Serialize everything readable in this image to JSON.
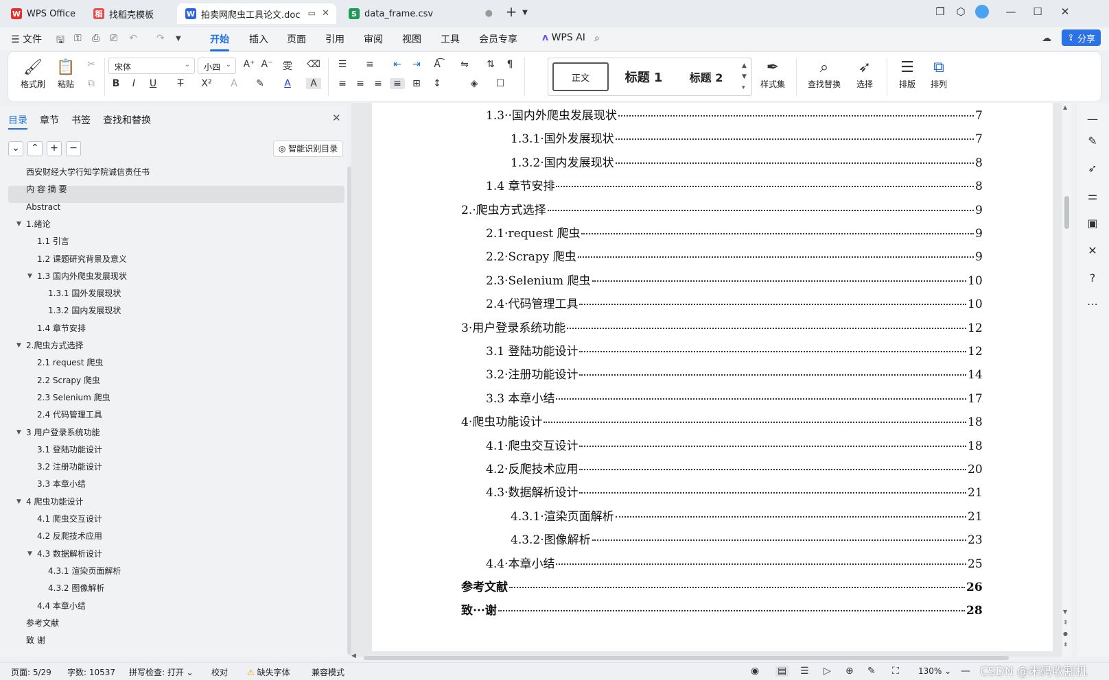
{
  "tabs": [
    {
      "label": "WPS Office",
      "icon": "wps-logo",
      "color": "#e0312b"
    },
    {
      "label": "找稻壳模板",
      "icon": "docer-icon",
      "color": "#e64c4c"
    },
    {
      "label": "拍卖网爬虫工具论文.doc",
      "icon": "word-doc-icon",
      "color": "#2b64e6",
      "active": true
    },
    {
      "label": "data_frame.csv",
      "icon": "sheet-icon",
      "color": "#1f9a55"
    }
  ],
  "menu": {
    "file": "文件",
    "items": [
      "开始",
      "插入",
      "页面",
      "引用",
      "审阅",
      "视图",
      "工具",
      "会员专享"
    ],
    "active": "开始",
    "wps_ai": "WPS AI",
    "share": "分享"
  },
  "ribbon": {
    "format_painter": "格式刷",
    "paste": "粘贴",
    "font": "宋体",
    "size": "小四",
    "styles": [
      "正文",
      "标题 1",
      "标题 2"
    ],
    "style_set": "样式集",
    "find_replace": "查找替换",
    "select": "选择",
    "layout": "排版",
    "arrange": "排列"
  },
  "sidebar": {
    "tabs": [
      "目录",
      "章节",
      "书签",
      "查找和替换"
    ],
    "active_tab": "目录",
    "smart_button": "智能识别目录",
    "items": [
      {
        "label": "西安财经大学行知学院诚信责任书",
        "level": 0,
        "arrow": ""
      },
      {
        "label": "内 容 摘 要",
        "level": 0,
        "arrow": "",
        "selected": true
      },
      {
        "label": "Abstract",
        "level": 0,
        "arrow": ""
      },
      {
        "label": "1.绪论",
        "level": 0,
        "arrow": "▼"
      },
      {
        "label": "1.1  引言",
        "level": 1,
        "arrow": ""
      },
      {
        "label": "1.2  课题研究背景及意义",
        "level": 1,
        "arrow": ""
      },
      {
        "label": "1.3    国内外爬虫发展现状",
        "level": 1,
        "arrow": "▼"
      },
      {
        "label": "1.3.1  国外发展现状",
        "level": 2,
        "arrow": ""
      },
      {
        "label": "1.3.2  国内发展现状",
        "level": 2,
        "arrow": ""
      },
      {
        "label": "1.4 章节安排",
        "level": 1,
        "arrow": ""
      },
      {
        "label": "2.爬虫方式选择",
        "level": 0,
        "arrow": "▼"
      },
      {
        "label": "2.1  request 爬虫",
        "level": 1,
        "arrow": ""
      },
      {
        "label": "2.2  Scrapy 爬虫",
        "level": 1,
        "arrow": ""
      },
      {
        "label": "2.3  Selenium 爬虫",
        "level": 1,
        "arrow": ""
      },
      {
        "label": "2.4  代码管理工具",
        "level": 1,
        "arrow": ""
      },
      {
        "label": "3  用户登录系统功能",
        "level": 0,
        "arrow": "▼"
      },
      {
        "label": "3.1 登陆功能设计",
        "level": 1,
        "arrow": ""
      },
      {
        "label": "3.2  注册功能设计",
        "level": 1,
        "arrow": ""
      },
      {
        "label": "3.3 本章小结",
        "level": 1,
        "arrow": ""
      },
      {
        "label": "4  爬虫功能设计",
        "level": 0,
        "arrow": "▼"
      },
      {
        "label": "4.1  爬虫交互设计",
        "level": 1,
        "arrow": ""
      },
      {
        "label": "4.2  反爬技术应用",
        "level": 1,
        "arrow": ""
      },
      {
        "label": "4.3  数据解析设计",
        "level": 1,
        "arrow": "▼"
      },
      {
        "label": "4.3.1  渲染页面解析",
        "level": 2,
        "arrow": ""
      },
      {
        "label": "4.3.2  图像解析",
        "level": 2,
        "arrow": ""
      },
      {
        "label": "4.4  本章小结",
        "level": 1,
        "arrow": ""
      },
      {
        "label": "参考文献",
        "level": 0,
        "arrow": ""
      },
      {
        "label": "致    谢",
        "level": 0,
        "arrow": ""
      }
    ]
  },
  "document": {
    "toc": [
      {
        "text": "1.3··国内外爬虫发展现状",
        "page": "7",
        "level": 1
      },
      {
        "text": "1.3.1·国外发展现状",
        "page": "7",
        "level": 2
      },
      {
        "text": "1.3.2·国内发展现状",
        "page": "8",
        "level": 2
      },
      {
        "text": "1.4 章节安排",
        "page": "8",
        "level": 1
      },
      {
        "text": "2.·爬虫方式选择",
        "page": "9",
        "level": 0
      },
      {
        "text": "2.1·request 爬虫",
        "page": "9",
        "level": 1
      },
      {
        "text": "2.2·Scrapy 爬虫",
        "page": "9",
        "level": 1
      },
      {
        "text": "2.3·Selenium 爬虫",
        "page": "10",
        "level": 1
      },
      {
        "text": "2.4·代码管理工具",
        "page": "10",
        "level": 1
      },
      {
        "text": "3·用户登录系统功能",
        "page": "12",
        "level": 0
      },
      {
        "text": "3.1 登陆功能设计",
        "page": "12",
        "level": 1
      },
      {
        "text": "3.2·注册功能设计",
        "page": "14",
        "level": 1
      },
      {
        "text": "3.3 本章小结",
        "page": "17",
        "level": 1
      },
      {
        "text": "4·爬虫功能设计",
        "page": "18",
        "level": 0
      },
      {
        "text": "4.1·爬虫交互设计",
        "page": "18",
        "level": 1
      },
      {
        "text": "4.2·反爬技术应用",
        "page": "20",
        "level": 1
      },
      {
        "text": "4.3·数据解析设计",
        "page": "21",
        "level": 1
      },
      {
        "text": "4.3.1·渲染页面解析",
        "page": "21",
        "level": 2
      },
      {
        "text": "4.3.2·图像解析",
        "page": "23",
        "level": 2
      },
      {
        "text": "4.4·本章小结",
        "page": "25",
        "level": 1
      },
      {
        "text": "参考文献",
        "page": "26",
        "level": 0,
        "bold": true
      },
      {
        "text": "致···谢",
        "page": "28",
        "level": 0,
        "bold": true
      }
    ]
  },
  "status": {
    "page": "页面: 5/29",
    "words": "字数: 10537",
    "spell": "拼写检查: 打开",
    "proof": "校对",
    "missing_font": "缺失字体",
    "compat": "兼容模式",
    "zoom": "130%"
  },
  "watermark": "CSDN @米码收割机"
}
